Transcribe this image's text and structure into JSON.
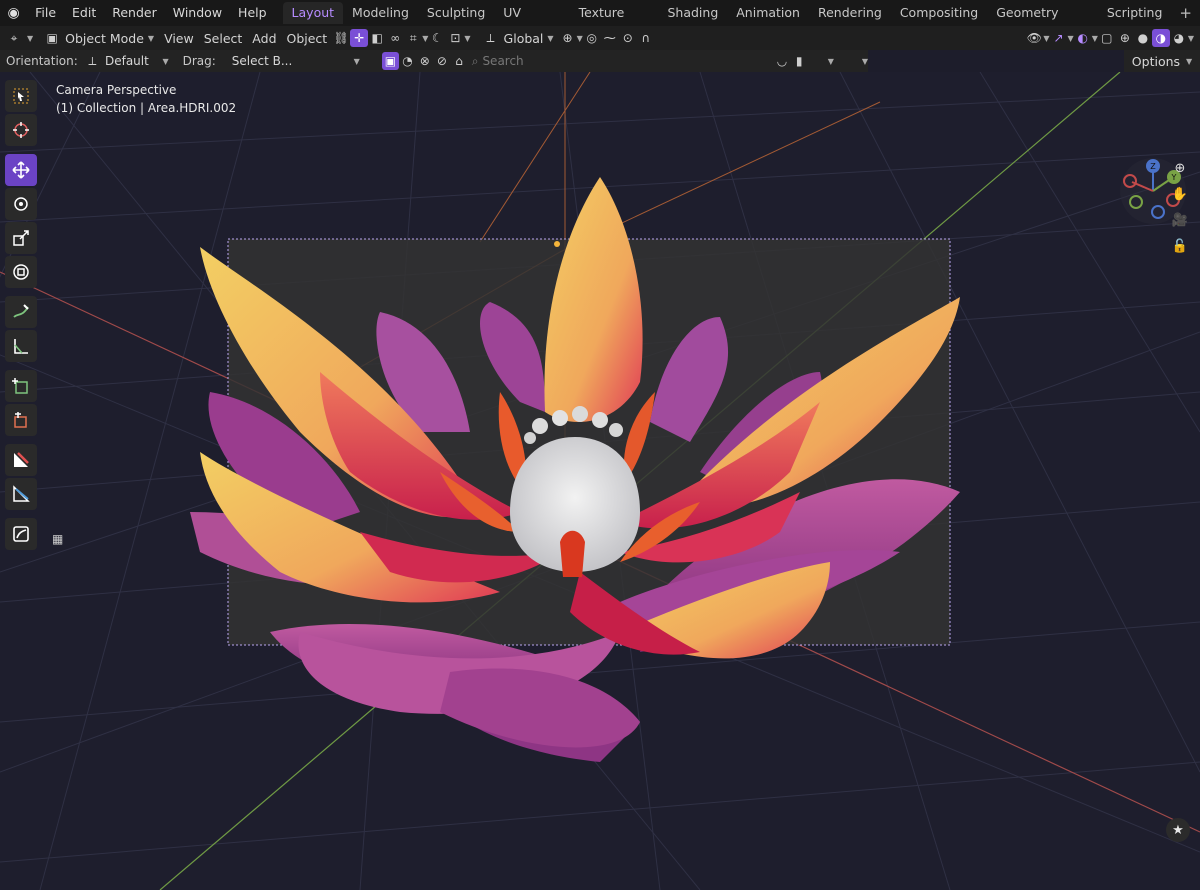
{
  "menu": {
    "items": [
      "File",
      "Edit",
      "Render",
      "Window",
      "Help"
    ],
    "workspaces": [
      "Layout",
      "Modeling",
      "Sculpting",
      "UV Editing",
      "Texture Paint",
      "Shading",
      "Animation",
      "Rendering",
      "Compositing",
      "Geometry Nodes",
      "Scripting"
    ],
    "active_workspace": "Layout",
    "add_symbol": "+"
  },
  "header": {
    "mode": "Object Mode",
    "view": "View",
    "select": "Select",
    "add": "Add",
    "object": "Object",
    "transform_orientation": "Global"
  },
  "toolsettings": {
    "orientation_label": "Orientation:",
    "orientation_value": "Default",
    "drag_label": "Drag:",
    "drag_value": "Select B...",
    "search_placeholder": "Search",
    "options_label": "Options"
  },
  "viewport": {
    "perspective_label": "Camera Perspective",
    "collection_label": "(1) Collection | Area.HDRI.002"
  },
  "colors": {
    "accent": "#7a4fd6",
    "active_tab_text": "#b68cff",
    "viewport_bg": "#1e1e2d",
    "grid_line": "#2f3044",
    "x_axis": "#a04a4a",
    "y_axis": "#7aa64a"
  },
  "gizmo": {
    "x": "X",
    "y": "Y",
    "z": "Z"
  },
  "toolbar_icons": [
    "select-box-icon",
    "cursor-icon",
    "move-icon",
    "rotate-icon",
    "scale-icon",
    "transform-icon",
    "annotate-icon",
    "measure-icon",
    "add-cube-icon",
    "extrude-icon",
    "shear-icon",
    "rip-icon",
    "render-region-icon"
  ]
}
